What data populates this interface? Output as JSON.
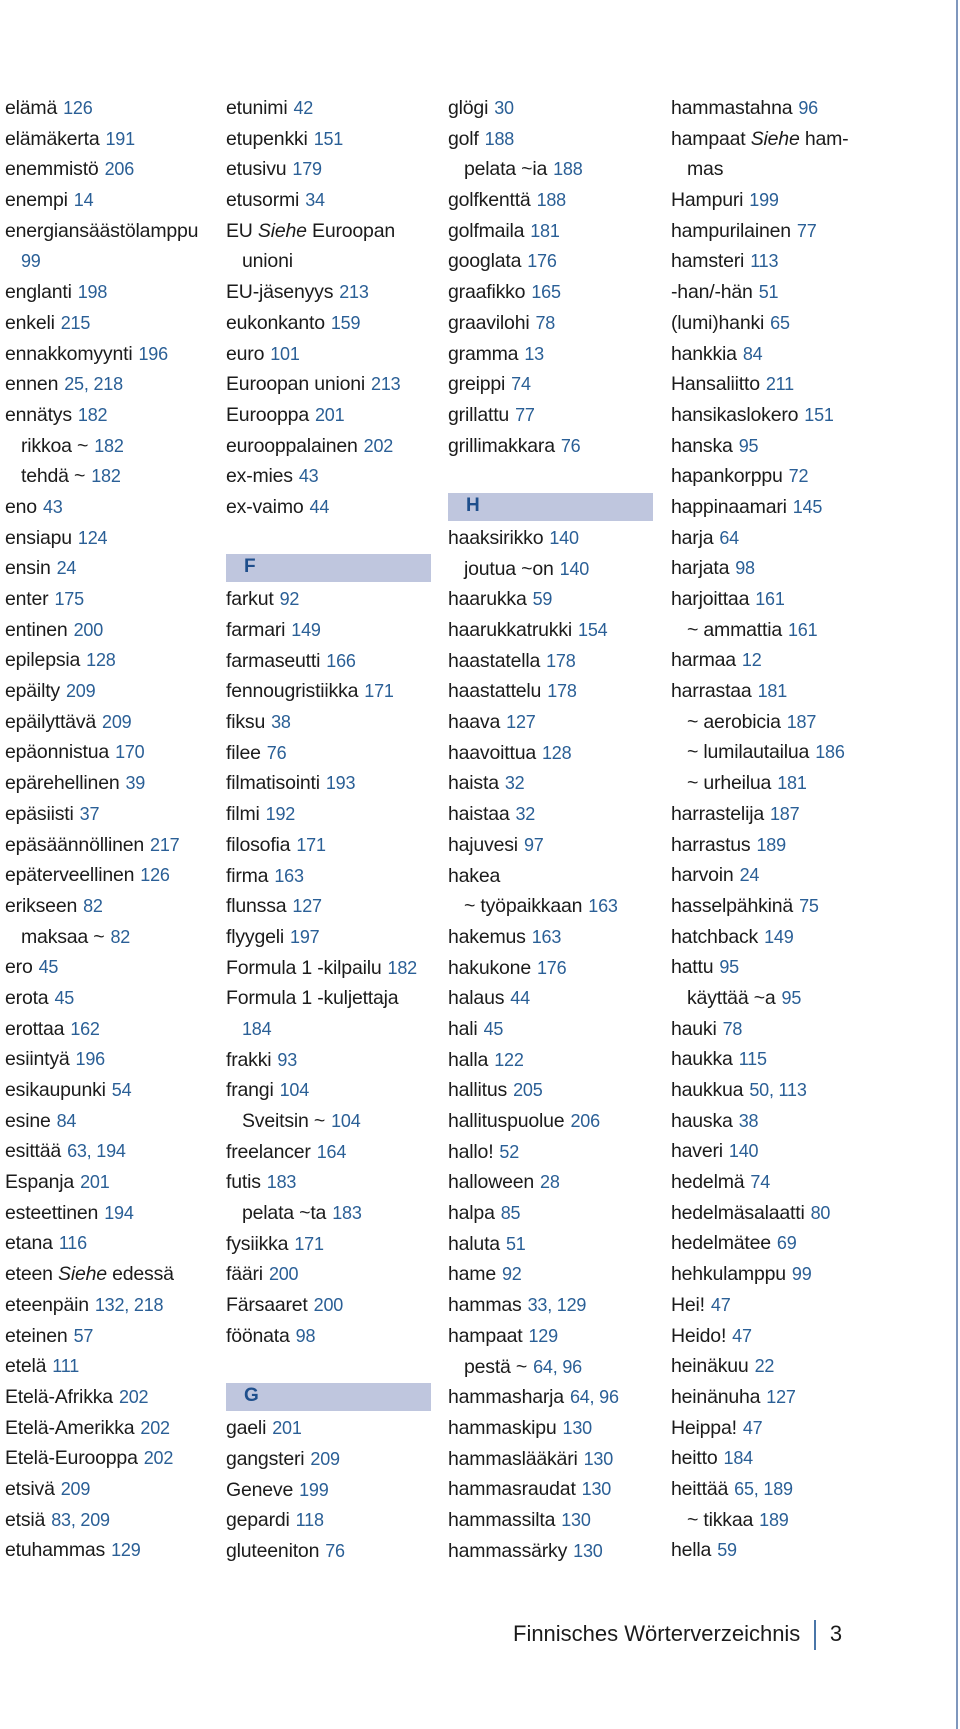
{
  "footer": {
    "title": "Finnisches Wörterverzeichnis",
    "page_number": "3"
  },
  "colors": {
    "page_number_blue": "#2a5f96",
    "section_band": "#bfc6de",
    "section_letter": "#1f4f8c",
    "edge_line": "#7f97bd"
  },
  "columns": [
    [
      {
        "t": "entry",
        "w": "elämä",
        "p": "126"
      },
      {
        "t": "entry",
        "w": "elämäkerta",
        "p": "191"
      },
      {
        "t": "entry",
        "w": "enemmistö",
        "p": "206"
      },
      {
        "t": "entry",
        "w": "enempi",
        "p": "14"
      },
      {
        "t": "entry",
        "w": "energiansäästölamppu",
        "p": ""
      },
      {
        "t": "cont",
        "w": "",
        "p": "99"
      },
      {
        "t": "entry",
        "w": "englanti",
        "p": "198"
      },
      {
        "t": "entry",
        "w": "enkeli",
        "p": "215"
      },
      {
        "t": "entry",
        "w": "ennakkomyynti",
        "p": "196"
      },
      {
        "t": "entry",
        "w": "ennen",
        "p": "25, 218"
      },
      {
        "t": "entry",
        "w": "ennätys",
        "p": "182"
      },
      {
        "t": "sub",
        "w": "rikkoa ~",
        "p": "182"
      },
      {
        "t": "sub",
        "w": "tehdä ~",
        "p": "182"
      },
      {
        "t": "entry",
        "w": "eno",
        "p": "43"
      },
      {
        "t": "entry",
        "w": "ensiapu",
        "p": "124"
      },
      {
        "t": "entry",
        "w": "ensin",
        "p": "24"
      },
      {
        "t": "entry",
        "w": "enter",
        "p": "175"
      },
      {
        "t": "entry",
        "w": "entinen",
        "p": "200"
      },
      {
        "t": "entry",
        "w": "epilepsia",
        "p": "128"
      },
      {
        "t": "entry",
        "w": "epäilty",
        "p": "209"
      },
      {
        "t": "entry",
        "w": "epäilyttävä",
        "p": "209"
      },
      {
        "t": "entry",
        "w": "epäonnistua",
        "p": "170"
      },
      {
        "t": "entry",
        "w": "epärehellinen",
        "p": "39"
      },
      {
        "t": "entry",
        "w": "epäsiisti",
        "p": "37"
      },
      {
        "t": "entry",
        "w": "epäsäännöllinen",
        "p": "217"
      },
      {
        "t": "entry",
        "w": "epäterveellinen",
        "p": "126"
      },
      {
        "t": "entry",
        "w": "erikseen",
        "p": "82"
      },
      {
        "t": "sub",
        "w": "maksaa ~",
        "p": "82"
      },
      {
        "t": "entry",
        "w": "ero",
        "p": "45"
      },
      {
        "t": "entry",
        "w": "erota",
        "p": "45"
      },
      {
        "t": "entry",
        "w": "erottaa",
        "p": "162"
      },
      {
        "t": "entry",
        "w": "esiintyä",
        "p": "196"
      },
      {
        "t": "entry",
        "w": "esikaupunki",
        "p": "54"
      },
      {
        "t": "entry",
        "w": "esine",
        "p": "84"
      },
      {
        "t": "entry",
        "w": "esittää",
        "p": "63, 194"
      },
      {
        "t": "entry",
        "w": "Espanja",
        "p": "201"
      },
      {
        "t": "entry",
        "w": "esteettinen",
        "p": "194"
      },
      {
        "t": "entry",
        "w": "etana",
        "p": "116"
      },
      {
        "t": "see",
        "w": "eteen",
        "s": "Siehe",
        "r": "edessä"
      },
      {
        "t": "entry",
        "w": "eteenpäin",
        "p": "132, 218"
      },
      {
        "t": "entry",
        "w": "eteinen",
        "p": "57"
      },
      {
        "t": "entry",
        "w": "etelä",
        "p": "111"
      },
      {
        "t": "entry",
        "w": "Etelä-Afrikka",
        "p": "202"
      },
      {
        "t": "entry",
        "w": "Etelä-Amerikka",
        "p": "202"
      },
      {
        "t": "entry",
        "w": "Etelä-Eurooppa",
        "p": "202"
      },
      {
        "t": "entry",
        "w": "etsivä",
        "p": "209"
      },
      {
        "t": "entry",
        "w": "etsiä",
        "p": "83, 209"
      },
      {
        "t": "entry",
        "w": "etuhammas",
        "p": "129"
      }
    ],
    [
      {
        "t": "entry",
        "w": "etunimi",
        "p": "42"
      },
      {
        "t": "entry",
        "w": "etupenkki",
        "p": "151"
      },
      {
        "t": "entry",
        "w": "etusivu",
        "p": "179"
      },
      {
        "t": "entry",
        "w": "etusormi",
        "p": "34"
      },
      {
        "t": "see",
        "w": "EU",
        "s": "Siehe",
        "r": "Euroopan"
      },
      {
        "t": "conttext",
        "w": "unioni"
      },
      {
        "t": "entry",
        "w": "EU-jäsenyys",
        "p": "213"
      },
      {
        "t": "entry",
        "w": "eukonkanto",
        "p": "159"
      },
      {
        "t": "entry",
        "w": "euro",
        "p": "101"
      },
      {
        "t": "entry",
        "w": "Euroopan unioni",
        "p": "213"
      },
      {
        "t": "entry",
        "w": "Eurooppa",
        "p": "201"
      },
      {
        "t": "entry",
        "w": "eurooppalainen",
        "p": "202"
      },
      {
        "t": "entry",
        "w": "ex-mies",
        "p": "43"
      },
      {
        "t": "entry",
        "w": "ex-vaimo",
        "p": "44"
      },
      {
        "t": "gap"
      },
      {
        "t": "header",
        "w": "F"
      },
      {
        "t": "entry",
        "w": "farkut",
        "p": "92"
      },
      {
        "t": "entry",
        "w": "farmari",
        "p": "149"
      },
      {
        "t": "entry",
        "w": "farmaseutti",
        "p": "166"
      },
      {
        "t": "entry",
        "w": "fennougristiikka",
        "p": "171"
      },
      {
        "t": "entry",
        "w": "fiksu",
        "p": "38"
      },
      {
        "t": "entry",
        "w": "filee",
        "p": "76"
      },
      {
        "t": "entry",
        "w": "filmatisointi",
        "p": "193"
      },
      {
        "t": "entry",
        "w": "filmi",
        "p": "192"
      },
      {
        "t": "entry",
        "w": "filosofia",
        "p": "171"
      },
      {
        "t": "entry",
        "w": "firma",
        "p": "163"
      },
      {
        "t": "entry",
        "w": "flunssa",
        "p": "127"
      },
      {
        "t": "entry",
        "w": "flyygeli",
        "p": "197"
      },
      {
        "t": "entry",
        "w": "Formula 1 -kilpailu",
        "p": "182"
      },
      {
        "t": "entry",
        "w": "Formula 1 -kuljettaja",
        "p": ""
      },
      {
        "t": "cont",
        "w": "",
        "p": "184"
      },
      {
        "t": "entry",
        "w": "frakki",
        "p": "93"
      },
      {
        "t": "entry",
        "w": "frangi",
        "p": "104"
      },
      {
        "t": "sub",
        "w": "Sveitsin ~",
        "p": "104"
      },
      {
        "t": "entry",
        "w": "freelancer",
        "p": "164"
      },
      {
        "t": "entry",
        "w": "futis",
        "p": "183"
      },
      {
        "t": "sub",
        "w": "pelata ~ta",
        "p": "183"
      },
      {
        "t": "entry",
        "w": "fysiikka",
        "p": "171"
      },
      {
        "t": "entry",
        "w": "fääri",
        "p": "200"
      },
      {
        "t": "entry",
        "w": "Färsaaret",
        "p": "200"
      },
      {
        "t": "entry",
        "w": "föönata",
        "p": "98"
      },
      {
        "t": "gap"
      },
      {
        "t": "header",
        "w": "G"
      },
      {
        "t": "entry",
        "w": "gaeli",
        "p": "201"
      },
      {
        "t": "entry",
        "w": "gangsteri",
        "p": "209"
      },
      {
        "t": "entry",
        "w": "Geneve",
        "p": "199"
      },
      {
        "t": "entry",
        "w": "gepardi",
        "p": "118"
      },
      {
        "t": "entry",
        "w": "gluteeniton",
        "p": "76"
      }
    ],
    [
      {
        "t": "entry",
        "w": "glögi",
        "p": "30"
      },
      {
        "t": "entry",
        "w": "golf",
        "p": "188"
      },
      {
        "t": "sub",
        "w": "pelata ~ia",
        "p": "188"
      },
      {
        "t": "entry",
        "w": "golfkenttä",
        "p": "188"
      },
      {
        "t": "entry",
        "w": "golfmaila",
        "p": "181"
      },
      {
        "t": "entry",
        "w": "googlata",
        "p": "176"
      },
      {
        "t": "entry",
        "w": "graafikko",
        "p": "165"
      },
      {
        "t": "entry",
        "w": "graavilohi",
        "p": "78"
      },
      {
        "t": "entry",
        "w": "gramma",
        "p": "13"
      },
      {
        "t": "entry",
        "w": "greippi",
        "p": "74"
      },
      {
        "t": "entry",
        "w": "grillattu",
        "p": "77"
      },
      {
        "t": "entry",
        "w": "grillimakkara",
        "p": "76"
      },
      {
        "t": "gap"
      },
      {
        "t": "header",
        "w": "H"
      },
      {
        "t": "entry",
        "w": "haaksirikko",
        "p": "140"
      },
      {
        "t": "sub",
        "w": "joutua ~on",
        "p": "140"
      },
      {
        "t": "entry",
        "w": "haarukka",
        "p": "59"
      },
      {
        "t": "entry",
        "w": "haarukkatrukki",
        "p": "154"
      },
      {
        "t": "entry",
        "w": "haastatella",
        "p": "178"
      },
      {
        "t": "entry",
        "w": "haastattelu",
        "p": "178"
      },
      {
        "t": "entry",
        "w": "haava",
        "p": "127"
      },
      {
        "t": "entry",
        "w": "haavoittua",
        "p": "128"
      },
      {
        "t": "entry",
        "w": "haista",
        "p": "32"
      },
      {
        "t": "entry",
        "w": "haistaa",
        "p": "32"
      },
      {
        "t": "entry",
        "w": "hajuvesi",
        "p": "97"
      },
      {
        "t": "entry",
        "w": "hakea",
        "p": ""
      },
      {
        "t": "sub",
        "w": "~ työpaikkaan",
        "p": "163"
      },
      {
        "t": "entry",
        "w": "hakemus",
        "p": "163"
      },
      {
        "t": "entry",
        "w": "hakukone",
        "p": "176"
      },
      {
        "t": "entry",
        "w": "halaus",
        "p": "44"
      },
      {
        "t": "entry",
        "w": "hali",
        "p": "45"
      },
      {
        "t": "entry",
        "w": "halla",
        "p": "122"
      },
      {
        "t": "entry",
        "w": "hallitus",
        "p": "205"
      },
      {
        "t": "entry",
        "w": "hallituspuolue",
        "p": "206"
      },
      {
        "t": "entry",
        "w": "hallo!",
        "p": "52"
      },
      {
        "t": "entry",
        "w": "halloween",
        "p": "28"
      },
      {
        "t": "entry",
        "w": "halpa",
        "p": "85"
      },
      {
        "t": "entry",
        "w": "haluta",
        "p": "51"
      },
      {
        "t": "entry",
        "w": "hame",
        "p": "92"
      },
      {
        "t": "entry",
        "w": "hammas",
        "p": "33, 129"
      },
      {
        "t": "entry",
        "w": "hampaat",
        "p": "129"
      },
      {
        "t": "sub",
        "w": "pestä ~",
        "p": "64, 96"
      },
      {
        "t": "entry",
        "w": "hammasharja",
        "p": "64, 96"
      },
      {
        "t": "entry",
        "w": "hammaskipu",
        "p": "130"
      },
      {
        "t": "entry",
        "w": "hammaslääkäri",
        "p": "130"
      },
      {
        "t": "entry",
        "w": "hammasraudat",
        "p": "130"
      },
      {
        "t": "entry",
        "w": "hammassilta",
        "p": "130"
      },
      {
        "t": "entry",
        "w": "hammassärky",
        "p": "130"
      }
    ],
    [
      {
        "t": "entry",
        "w": "hammastahna",
        "p": "96"
      },
      {
        "t": "see",
        "w": "hampaat",
        "s": "Siehe",
        "r": "ham-"
      },
      {
        "t": "conttext",
        "w": "mas"
      },
      {
        "t": "entry",
        "w": "Hampuri",
        "p": "199"
      },
      {
        "t": "entry",
        "w": "hampurilainen",
        "p": "77"
      },
      {
        "t": "entry",
        "w": "hamsteri",
        "p": "113"
      },
      {
        "t": "entry",
        "w": "-han/-hän",
        "p": "51"
      },
      {
        "t": "entry",
        "w": "(lumi)hanki",
        "p": "65"
      },
      {
        "t": "entry",
        "w": "hankkia",
        "p": "84"
      },
      {
        "t": "entry",
        "w": "Hansaliitto",
        "p": "211"
      },
      {
        "t": "entry",
        "w": "hansikaslokero",
        "p": "151"
      },
      {
        "t": "entry",
        "w": "hanska",
        "p": "95"
      },
      {
        "t": "entry",
        "w": "hapankorppu",
        "p": "72"
      },
      {
        "t": "entry",
        "w": "happinaamari",
        "p": "145"
      },
      {
        "t": "entry",
        "w": "harja",
        "p": "64"
      },
      {
        "t": "entry",
        "w": "harjata",
        "p": "98"
      },
      {
        "t": "entry",
        "w": "harjoittaa",
        "p": "161"
      },
      {
        "t": "sub",
        "w": "~ ammattia",
        "p": "161"
      },
      {
        "t": "entry",
        "w": "harmaa",
        "p": "12"
      },
      {
        "t": "entry",
        "w": "harrastaa",
        "p": "181"
      },
      {
        "t": "sub",
        "w": "~ aerobicia",
        "p": "187"
      },
      {
        "t": "sub",
        "w": "~ lumilautailua",
        "p": "186"
      },
      {
        "t": "sub",
        "w": "~ urheilua",
        "p": "181"
      },
      {
        "t": "entry",
        "w": "harrastelija",
        "p": "187"
      },
      {
        "t": "entry",
        "w": "harrastus",
        "p": "189"
      },
      {
        "t": "entry",
        "w": "harvoin",
        "p": "24"
      },
      {
        "t": "entry",
        "w": "hasselpähkinä",
        "p": "75"
      },
      {
        "t": "entry",
        "w": "hatchback",
        "p": "149"
      },
      {
        "t": "entry",
        "w": "hattu",
        "p": "95"
      },
      {
        "t": "sub",
        "w": "käyttää ~a",
        "p": "95"
      },
      {
        "t": "entry",
        "w": "hauki",
        "p": "78"
      },
      {
        "t": "entry",
        "w": "haukka",
        "p": "115"
      },
      {
        "t": "entry",
        "w": "haukkua",
        "p": "50, 113"
      },
      {
        "t": "entry",
        "w": "hauska",
        "p": "38"
      },
      {
        "t": "entry",
        "w": "haveri",
        "p": "140"
      },
      {
        "t": "entry",
        "w": "hedelmä",
        "p": "74"
      },
      {
        "t": "entry",
        "w": "hedelmäsalaatti",
        "p": "80"
      },
      {
        "t": "entry",
        "w": "hedelmätee",
        "p": "69"
      },
      {
        "t": "entry",
        "w": "hehkulamppu",
        "p": "99"
      },
      {
        "t": "entry",
        "w": "Hei!",
        "p": "47"
      },
      {
        "t": "entry",
        "w": "Heido!",
        "p": "47"
      },
      {
        "t": "entry",
        "w": "heinäkuu",
        "p": "22"
      },
      {
        "t": "entry",
        "w": "heinänuha",
        "p": "127"
      },
      {
        "t": "entry",
        "w": "Heippa!",
        "p": "47"
      },
      {
        "t": "entry",
        "w": "heitto",
        "p": "184"
      },
      {
        "t": "entry",
        "w": "heittää",
        "p": "65, 189"
      },
      {
        "t": "sub",
        "w": "~ tikkaa",
        "p": "189"
      },
      {
        "t": "entry",
        "w": "hella",
        "p": "59"
      }
    ]
  ]
}
